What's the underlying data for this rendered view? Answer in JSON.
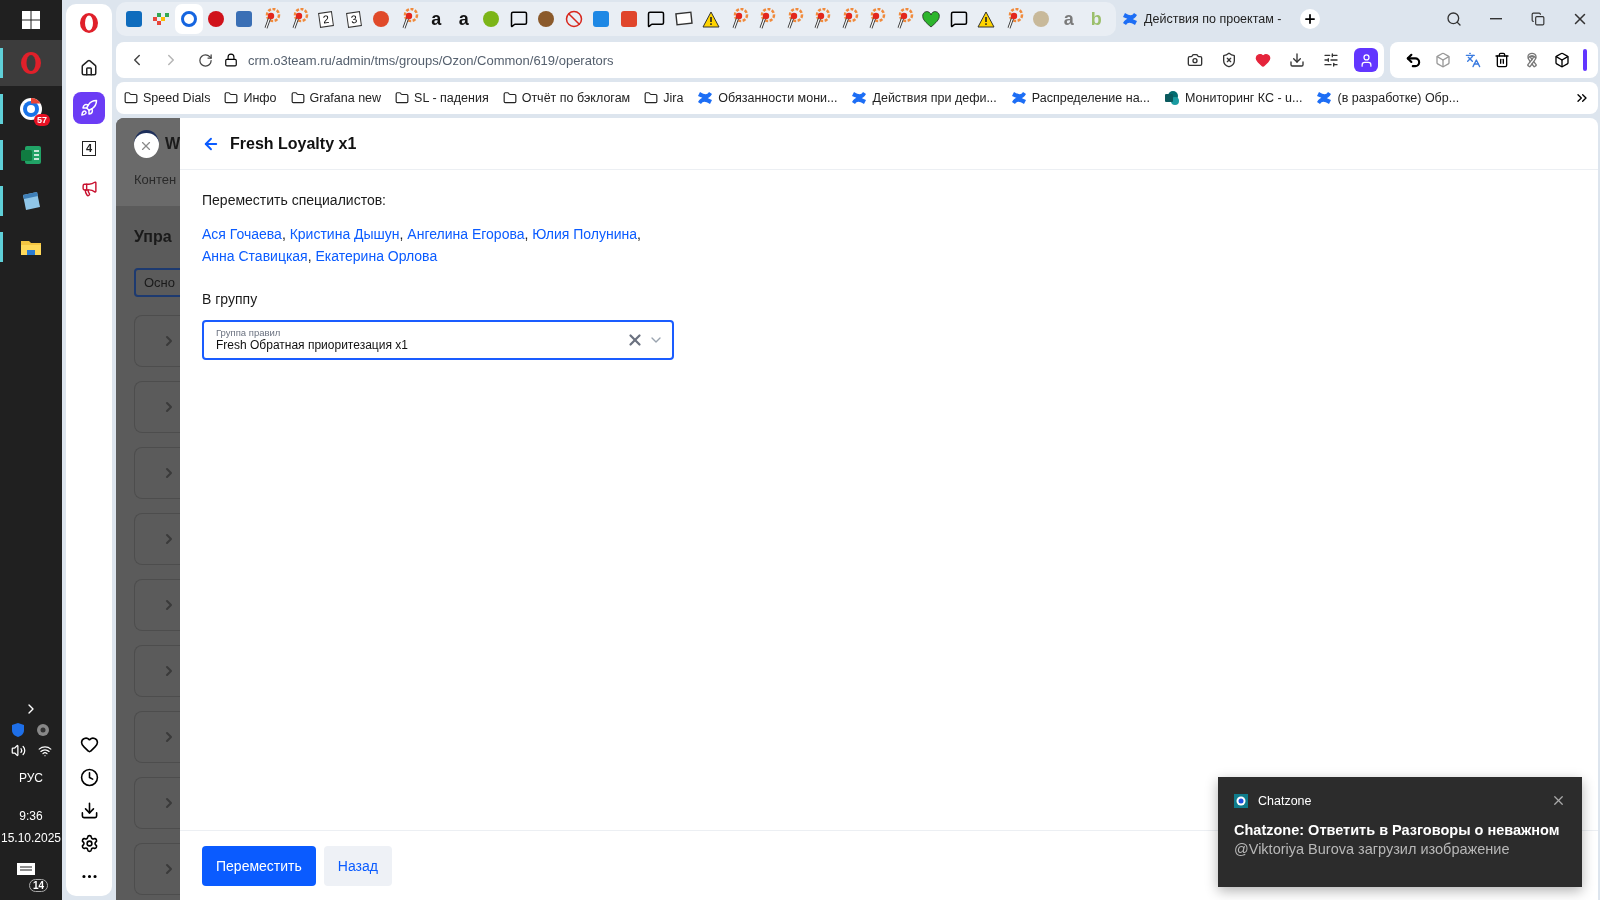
{
  "taskbar": {
    "apps": [
      {
        "kind": "opera",
        "selected": true,
        "running": true
      },
      {
        "kind": "chrome",
        "badge": "57",
        "selected": false,
        "running": true
      },
      {
        "kind": "sheet",
        "selected": false,
        "running": true
      },
      {
        "kind": "notepad",
        "selected": false,
        "running": true
      },
      {
        "kind": "folder",
        "selected": false,
        "running": true
      }
    ],
    "language": "РУС",
    "time": "9:36",
    "date": "15.10.2025",
    "notifications": "14"
  },
  "opera_sidebar": {
    "top": [
      {
        "kind": "home",
        "selected": false
      },
      {
        "kind": "rocket",
        "selected": true
      },
      {
        "kind": "glyph",
        "glyph": "4",
        "selected": false
      },
      {
        "kind": "megaphone",
        "selected": false
      }
    ],
    "bottom": [
      {
        "kind": "heart"
      },
      {
        "kind": "clock"
      },
      {
        "kind": "download"
      },
      {
        "kind": "settings"
      },
      {
        "kind": "more"
      }
    ]
  },
  "pinned_tabs": [
    {
      "kind": "square",
      "color": "#0f6cbd",
      "selected": false
    },
    {
      "kind": "grid",
      "selected": false
    },
    {
      "kind": "ring",
      "selected": true
    },
    {
      "kind": "circle",
      "color": "#d0121b",
      "selected": false
    },
    {
      "kind": "square",
      "color": "#3a6fb5",
      "selected": false
    },
    {
      "kind": "pin",
      "selected": false
    },
    {
      "kind": "pin",
      "selected": false
    },
    {
      "kind": "boxed",
      "glyph": "2",
      "selected": false
    },
    {
      "kind": "boxed",
      "glyph": "3",
      "selected": false
    },
    {
      "kind": "circle",
      "color": "#e04a2a",
      "selected": false
    },
    {
      "kind": "pin",
      "selected": false
    },
    {
      "kind": "glyph",
      "glyph": "a",
      "color": "#111111",
      "selected": false
    },
    {
      "kind": "glyph",
      "glyph": "a",
      "color": "#111111",
      "selected": false
    },
    {
      "kind": "circle",
      "color": "#7cb518",
      "selected": false
    },
    {
      "kind": "chat",
      "selected": false
    },
    {
      "kind": "circle",
      "color": "#8b5a2b",
      "selected": false
    },
    {
      "kind": "ban",
      "selected": false
    },
    {
      "kind": "square",
      "color": "#1e88e5",
      "selected": false
    },
    {
      "kind": "square",
      "color": "#e0452b",
      "selected": false
    },
    {
      "kind": "chat",
      "selected": false
    },
    {
      "kind": "frame",
      "selected": false
    },
    {
      "kind": "warning",
      "selected": false
    },
    {
      "kind": "pin",
      "selected": false
    },
    {
      "kind": "pin",
      "selected": false
    },
    {
      "kind": "pin",
      "selected": false
    },
    {
      "kind": "pin",
      "selected": false
    },
    {
      "kind": "pin",
      "selected": false
    },
    {
      "kind": "pin",
      "selected": false
    },
    {
      "kind": "pin",
      "selected": false
    },
    {
      "kind": "heart",
      "selected": false
    },
    {
      "kind": "chat",
      "selected": false
    },
    {
      "kind": "warning",
      "selected": false
    },
    {
      "kind": "pin",
      "selected": false
    },
    {
      "kind": "circle",
      "color": "#c8b99a",
      "selected": false
    },
    {
      "kind": "glyph",
      "glyph": "a",
      "color": "#7a7a7a",
      "selected": false
    },
    {
      "kind": "glyph",
      "glyph": "b",
      "color": "#9bbf6b",
      "selected": false
    }
  ],
  "active_tab": {
    "title": "Действия по проектам -"
  },
  "address_bar": {
    "url": "crm.o3team.ru/admin/tms/groups/Ozon/Common/619/operators"
  },
  "bookmarks": [
    {
      "kind": "folder",
      "label": "Speed Dials"
    },
    {
      "kind": "folder",
      "label": "Инфо"
    },
    {
      "kind": "folder",
      "label": "Grafana new"
    },
    {
      "kind": "folder",
      "label": "SL - падения"
    },
    {
      "kind": "folder",
      "label": "Отчёт по бэклогам"
    },
    {
      "kind": "folder",
      "label": "Jira"
    },
    {
      "kind": "confluence",
      "label": "Обязанности мони..."
    },
    {
      "kind": "confluence",
      "label": "Действия при дефи..."
    },
    {
      "kind": "confluence",
      "label": "Распределение на..."
    },
    {
      "kind": "sharepoint",
      "label": "Мониторинг КС - u..."
    },
    {
      "kind": "confluence",
      "label": "(в разработке) Обр..."
    }
  ],
  "background_page": {
    "title": "W",
    "tab": "Контен",
    "heading": "Упра",
    "button": "Осно",
    "rows": [
      {
        "expanded": false
      },
      {
        "expanded": false
      },
      {
        "expanded": false
      },
      {
        "expanded": false
      },
      {
        "expanded": false
      },
      {
        "expanded": false
      },
      {
        "expanded": false
      },
      {
        "expanded": false
      },
      {
        "expanded": false
      }
    ]
  },
  "drawer": {
    "title": "Fresh Loyalty x1",
    "move_label": "Переместить специалистов:",
    "specialists": [
      "Ася Гочаева",
      "Кристина Дышун",
      "Ангелина Егорова",
      "Юлия Полунина",
      "Анна Ставицкая",
      "Екатерина Орлова"
    ],
    "separator": ",",
    "group_label": "В группу",
    "select": {
      "label": "Группа правил",
      "value": "Fresh Обратная приоритезация x1"
    },
    "buttons": [
      {
        "kind": "primary",
        "label": "Переместить"
      },
      {
        "kind": "secondary",
        "label": "Назад"
      }
    ]
  },
  "notification": {
    "app": "Chatzone",
    "title": "Chatzone: Ответить в Разговоры о неважном",
    "body": "@Viktoriya Burova загрузил изображение"
  }
}
